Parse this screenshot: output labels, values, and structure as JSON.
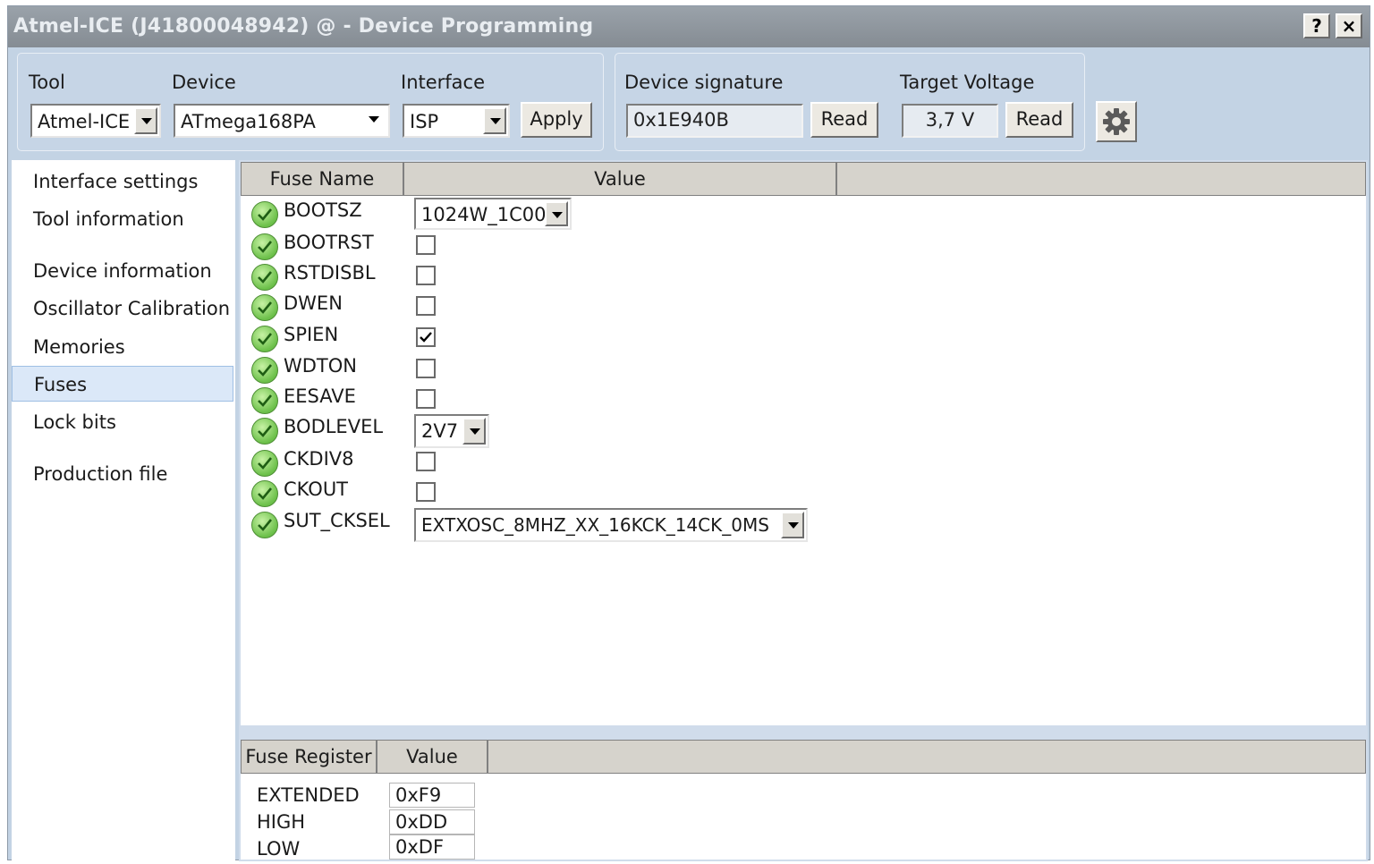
{
  "window": {
    "title": "Atmel-ICE (J41800048942) @  - Device Programming",
    "help_label": "?",
    "close_label": "×"
  },
  "toolbar": {
    "tool_label": "Tool",
    "tool_value": "Atmel-ICE",
    "device_label": "Device",
    "device_value": "ATmega168PA",
    "interface_label": "Interface",
    "interface_value": "ISP",
    "apply_label": "Apply",
    "signature_label": "Device signature",
    "signature_value": "0x1E940B",
    "read_signature_label": "Read",
    "voltage_label": "Target Voltage",
    "voltage_value": "3,7 V",
    "read_voltage_label": "Read",
    "settings_icon": "gear-icon"
  },
  "sidebar": {
    "items": [
      {
        "label": "Interface settings"
      },
      {
        "label": "Tool information"
      },
      {
        "label": "Device information"
      },
      {
        "label": "Oscillator Calibration"
      },
      {
        "label": "Memories"
      },
      {
        "label": "Fuses"
      },
      {
        "label": "Lock bits"
      },
      {
        "label": "Production file"
      }
    ],
    "selected": "Fuses"
  },
  "fuses": {
    "col_name": "Fuse Name",
    "col_value": "Value",
    "status_icon": "check-circle-icon",
    "rows": [
      {
        "name": "BOOTSZ",
        "value": "1024W_1C00"
      },
      {
        "name": "BOOTRST",
        "checked": false
      },
      {
        "name": "RSTDISBL",
        "checked": false
      },
      {
        "name": "DWEN",
        "checked": false
      },
      {
        "name": "SPIEN",
        "checked": true
      },
      {
        "name": "WDTON",
        "checked": false
      },
      {
        "name": "EESAVE",
        "checked": false
      },
      {
        "name": "BODLEVEL",
        "value": "2V7"
      },
      {
        "name": "CKDIV8",
        "checked": false
      },
      {
        "name": "CKOUT",
        "checked": false
      },
      {
        "name": "SUT_CKSEL",
        "value": "EXTXOSC_8MHZ_XX_16KCK_14CK_0MS"
      }
    ]
  },
  "registers": {
    "col_name": "Fuse Register",
    "col_value": "Value",
    "rows": [
      {
        "name": "EXTENDED",
        "value": "0xF9"
      },
      {
        "name": "HIGH",
        "value": "0xDD"
      },
      {
        "name": "LOW",
        "value": "0xDF"
      }
    ]
  }
}
